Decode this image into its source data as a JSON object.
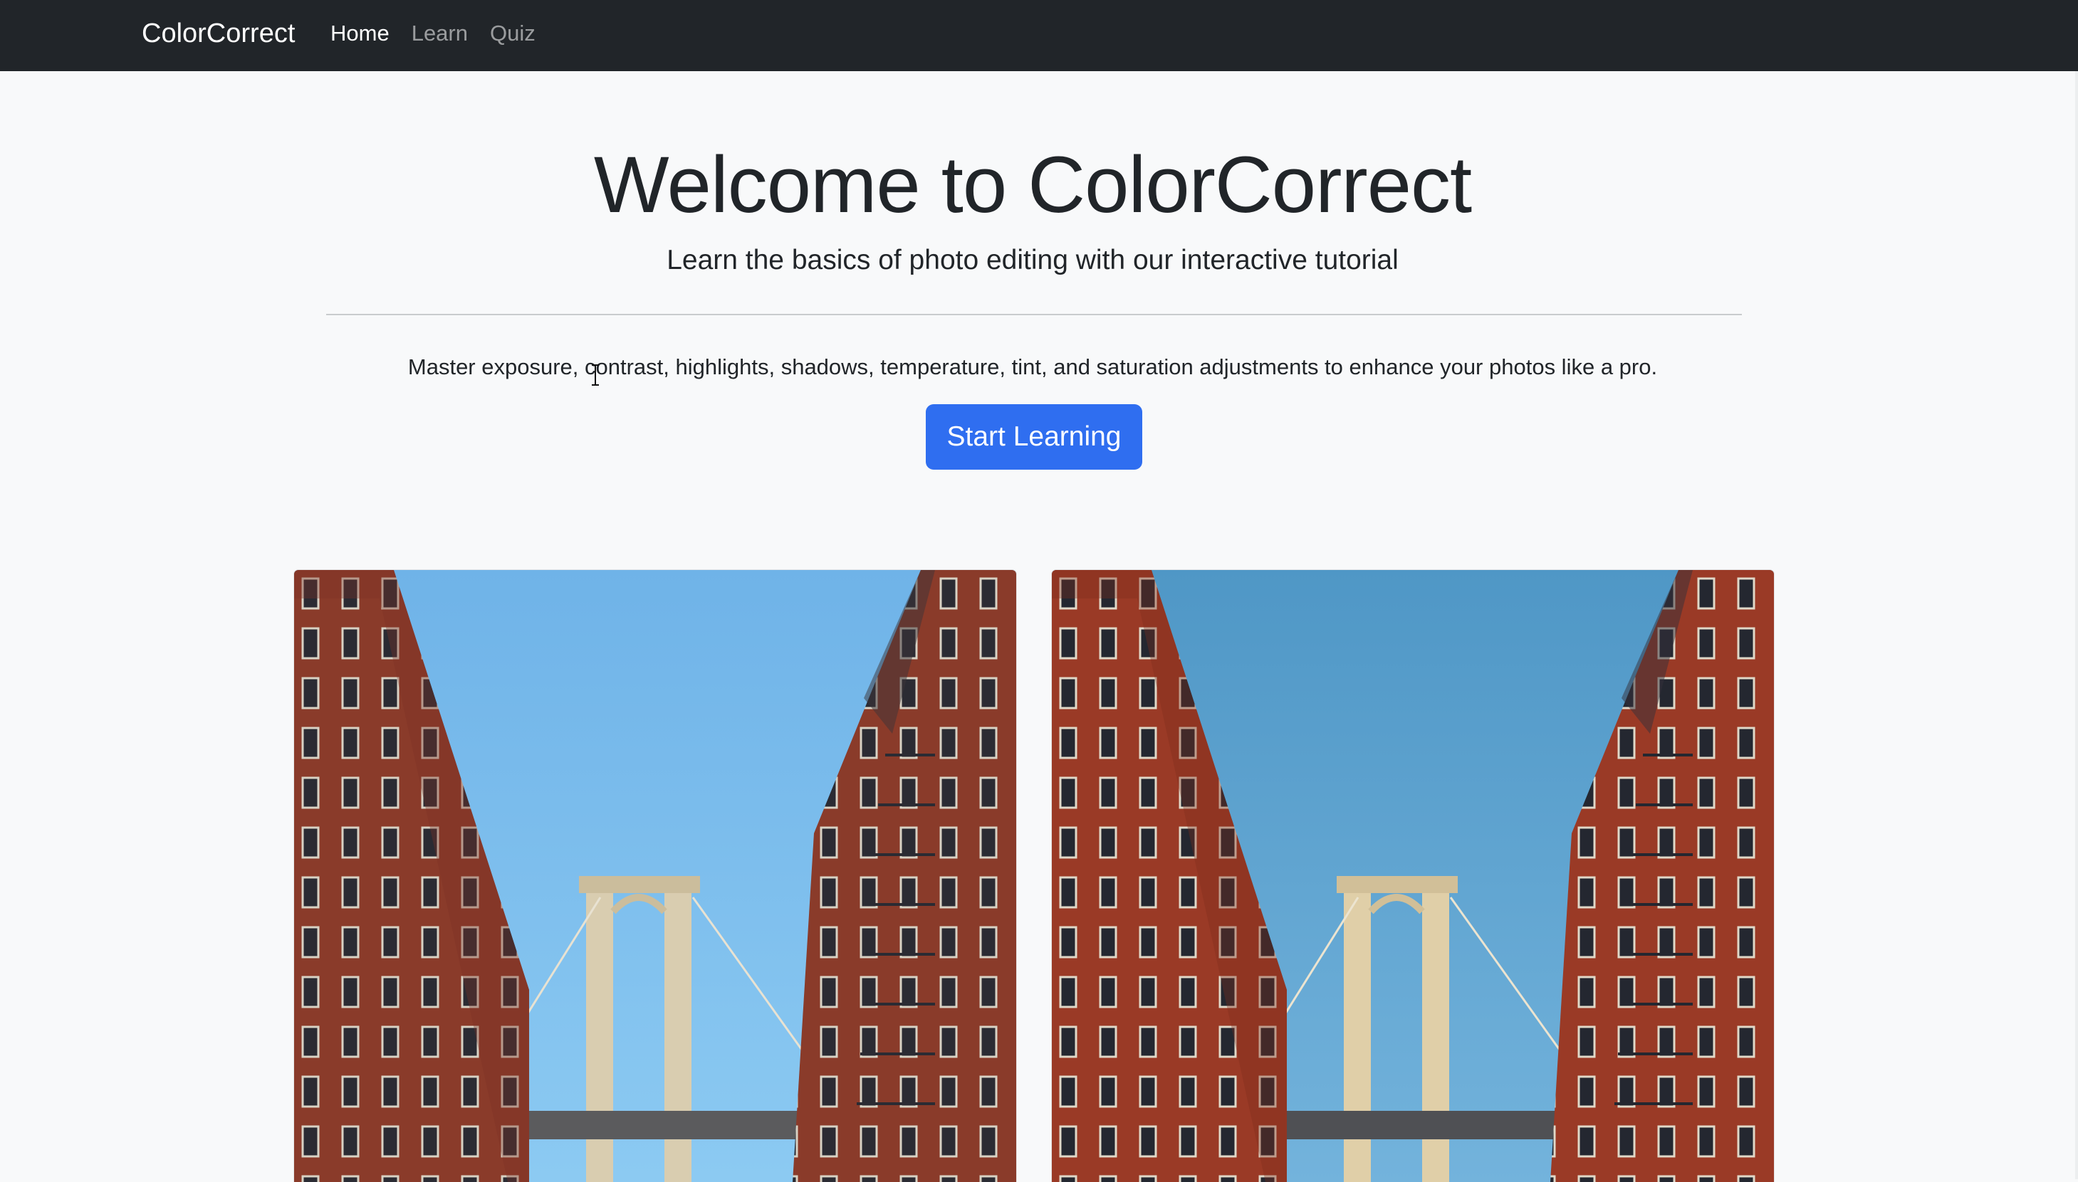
{
  "navbar": {
    "brand": "ColorCorrect",
    "links": [
      {
        "label": "Home",
        "active": true
      },
      {
        "label": "Learn",
        "active": false
      },
      {
        "label": "Quiz",
        "active": false
      }
    ]
  },
  "hero": {
    "title": "Welcome to ColorCorrect",
    "subtitle": "Learn the basics of photo editing with our interactive tutorial",
    "description": "Master exposure, contrast, highlights, shadows, temperature, tint, and saturation adjustments to enhance your photos like a pro.",
    "button_label": "Start Learning"
  },
  "images": [
    {
      "sky_top": "#6fb3e8",
      "sky_bottom": "#8ccaf2"
    },
    {
      "sky_top": "#4f97c6",
      "sky_bottom": "#73b3dc"
    }
  ],
  "colors": {
    "navbar": "#212529",
    "background": "#f8f9fa",
    "primary_button": "#2f6ef0"
  }
}
